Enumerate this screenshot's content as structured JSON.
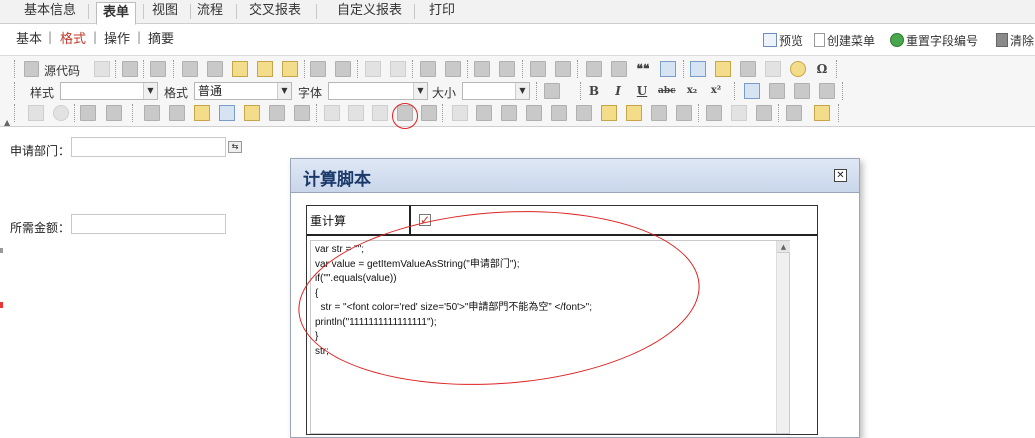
{
  "tabs": [
    {
      "label": "基本信息"
    },
    {
      "label": "表单"
    },
    {
      "label": "视图"
    },
    {
      "label": "流程"
    },
    {
      "label": "交叉报表"
    },
    {
      "label": "自定义报表"
    },
    {
      "label": "打印"
    }
  ],
  "subnav": {
    "items": [
      "基本",
      "格式",
      "操作",
      "摘要"
    ],
    "separator": "|"
  },
  "actions": {
    "preview": "预览",
    "create_menu": "创建菜单",
    "reset_field_no": "重置字段编号",
    "clear": "清除"
  },
  "toolbar": {
    "source": "源代码",
    "style_label": "样式",
    "style_value": "",
    "format_label": "格式",
    "format_value": "普通",
    "font_label": "字体",
    "font_value": "",
    "size_label": "大小",
    "size_value": "",
    "bold": "B",
    "italic": "I",
    "underline": "U",
    "strike": "abc",
    "subscript": "x₂",
    "superscript": "x²",
    "omega": "Ω",
    "quote": "❝❝"
  },
  "form": {
    "department_label": "申请部门：",
    "amount_label": "所需金额："
  },
  "dialog": {
    "title": "计算脚本",
    "close": "✕",
    "recalc_label": "重计算",
    "recalc_checked": "✓",
    "code": "var str = \"\";\nvar value = getItemValueAsString(\"申请部门\");\nif(\"\".equals(value))\n{\n  str = \"<font color='red' size='50'>\"申請部門不能為空” </font>\";\nprintln(\"1111111111111111\");\n}\nstr;"
  },
  "colors": {
    "active_sub": "#c0392b",
    "dialog_title": "#1b3a6b",
    "annotation": "#d22222"
  }
}
